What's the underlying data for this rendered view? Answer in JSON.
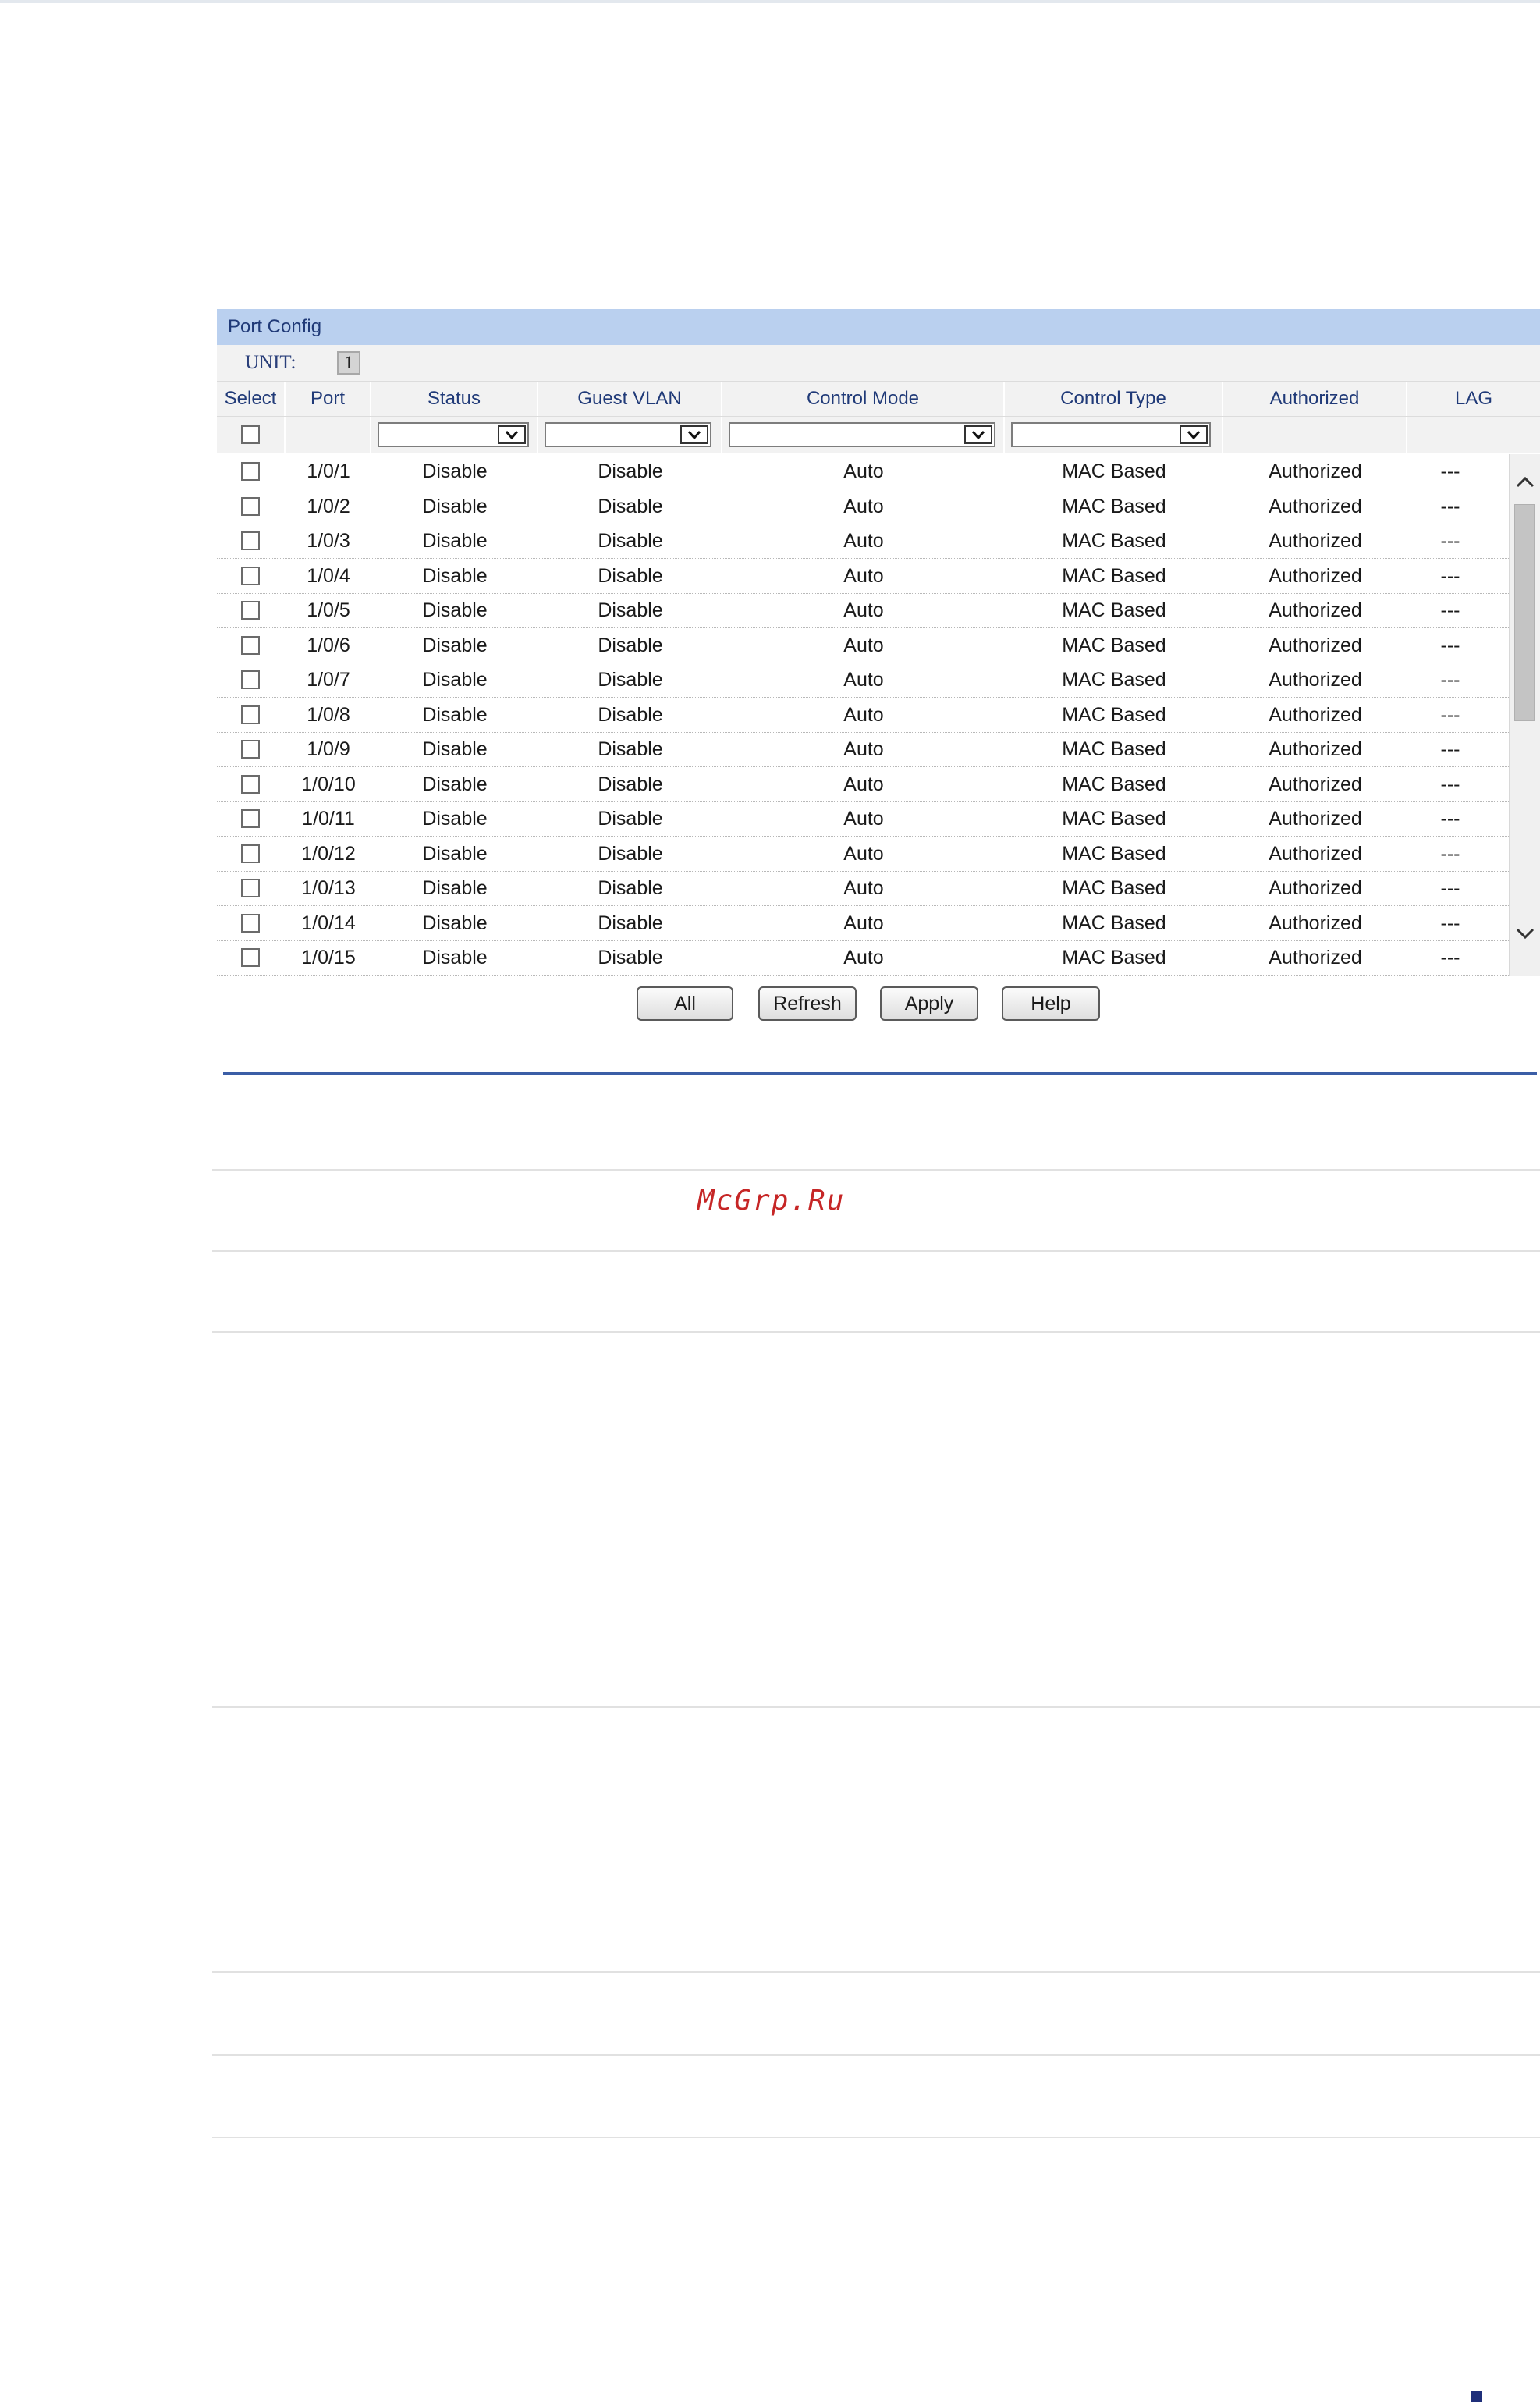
{
  "panel": {
    "title": "Port Config",
    "unit_label": "UNIT:",
    "unit_value": "1"
  },
  "columns": [
    "Select",
    "Port",
    "Status",
    "Guest VLAN",
    "Control Mode",
    "Control Type",
    "Authorized",
    "LAG"
  ],
  "rows": [
    {
      "port": "1/0/1",
      "status": "Disable",
      "guest_vlan": "Disable",
      "control_mode": "Auto",
      "control_type": "MAC Based",
      "authorized": "Authorized",
      "lag": "---"
    },
    {
      "port": "1/0/2",
      "status": "Disable",
      "guest_vlan": "Disable",
      "control_mode": "Auto",
      "control_type": "MAC Based",
      "authorized": "Authorized",
      "lag": "---"
    },
    {
      "port": "1/0/3",
      "status": "Disable",
      "guest_vlan": "Disable",
      "control_mode": "Auto",
      "control_type": "MAC Based",
      "authorized": "Authorized",
      "lag": "---"
    },
    {
      "port": "1/0/4",
      "status": "Disable",
      "guest_vlan": "Disable",
      "control_mode": "Auto",
      "control_type": "MAC Based",
      "authorized": "Authorized",
      "lag": "---"
    },
    {
      "port": "1/0/5",
      "status": "Disable",
      "guest_vlan": "Disable",
      "control_mode": "Auto",
      "control_type": "MAC Based",
      "authorized": "Authorized",
      "lag": "---"
    },
    {
      "port": "1/0/6",
      "status": "Disable",
      "guest_vlan": "Disable",
      "control_mode": "Auto",
      "control_type": "MAC Based",
      "authorized": "Authorized",
      "lag": "---"
    },
    {
      "port": "1/0/7",
      "status": "Disable",
      "guest_vlan": "Disable",
      "control_mode": "Auto",
      "control_type": "MAC Based",
      "authorized": "Authorized",
      "lag": "---"
    },
    {
      "port": "1/0/8",
      "status": "Disable",
      "guest_vlan": "Disable",
      "control_mode": "Auto",
      "control_type": "MAC Based",
      "authorized": "Authorized",
      "lag": "---"
    },
    {
      "port": "1/0/9",
      "status": "Disable",
      "guest_vlan": "Disable",
      "control_mode": "Auto",
      "control_type": "MAC Based",
      "authorized": "Authorized",
      "lag": "---"
    },
    {
      "port": "1/0/10",
      "status": "Disable",
      "guest_vlan": "Disable",
      "control_mode": "Auto",
      "control_type": "MAC Based",
      "authorized": "Authorized",
      "lag": "---"
    },
    {
      "port": "1/0/11",
      "status": "Disable",
      "guest_vlan": "Disable",
      "control_mode": "Auto",
      "control_type": "MAC Based",
      "authorized": "Authorized",
      "lag": "---"
    },
    {
      "port": "1/0/12",
      "status": "Disable",
      "guest_vlan": "Disable",
      "control_mode": "Auto",
      "control_type": "MAC Based",
      "authorized": "Authorized",
      "lag": "---"
    },
    {
      "port": "1/0/13",
      "status": "Disable",
      "guest_vlan": "Disable",
      "control_mode": "Auto",
      "control_type": "MAC Based",
      "authorized": "Authorized",
      "lag": "---"
    },
    {
      "port": "1/0/14",
      "status": "Disable",
      "guest_vlan": "Disable",
      "control_mode": "Auto",
      "control_type": "MAC Based",
      "authorized": "Authorized",
      "lag": "---"
    },
    {
      "port": "1/0/15",
      "status": "Disable",
      "guest_vlan": "Disable",
      "control_mode": "Auto",
      "control_type": "MAC Based",
      "authorized": "Authorized",
      "lag": "---"
    }
  ],
  "buttons": {
    "all": "All",
    "refresh": "Refresh",
    "apply": "Apply",
    "help": "Help"
  },
  "watermark": "McGrp.Ru",
  "icons": {
    "dropdown": "chevron-down-icon",
    "scroll_up": "chevron-up-icon",
    "scroll_down": "chevron-down-icon"
  },
  "colors": {
    "title_bar": "#bad0ef",
    "header_text": "#203a78",
    "watermark": "#c62626",
    "rule": "#3b5ea6"
  }
}
